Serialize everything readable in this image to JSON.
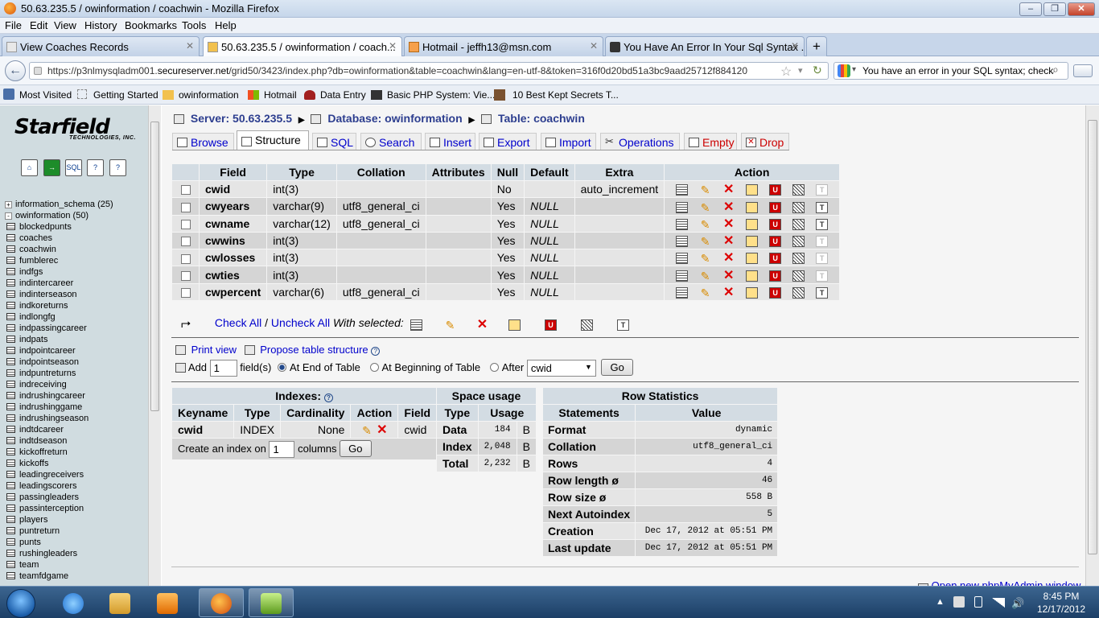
{
  "window": {
    "title": "50.63.235.5 / owinformation / coachwin - Mozilla Firefox"
  },
  "menu": [
    "File",
    "Edit",
    "View",
    "History",
    "Bookmarks",
    "Tools",
    "Help"
  ],
  "tabs": [
    {
      "label": "View Coaches Records"
    },
    {
      "label": "50.63.235.5 / owinformation / coach..."
    },
    {
      "label": "Hotmail - jeffh13@msn.com"
    },
    {
      "label": "You Have An Error In Your Sql Syntax ..."
    }
  ],
  "nav": {
    "url_prefix": "https://p3nlmysqladm001.",
    "url_domain": "secureserver.net",
    "url_rest": "/grid50/3423/index.php?db=owinformation&table=coachwin&lang=en-utf-8&token=316f0d20bd51a3bc9aad25712f884120",
    "search": "You have an error in your SQL syntax; check"
  },
  "bookmarks": [
    "Most Visited",
    "Getting Started",
    "owinformation",
    "Hotmail",
    "Data Entry",
    "Basic PHP System: Vie...",
    "10 Best Kept Secrets T..."
  ],
  "sidebar": {
    "logo": "Starfield",
    "logo_sub": "TECHNOLOGIES, INC.",
    "dbs": [
      {
        "name": "information_schema (25)",
        "sign": "+"
      },
      {
        "name": "owinformation (50)",
        "sign": "-"
      }
    ],
    "tables": [
      "blockedpunts",
      "coaches",
      "coachwin",
      "fumblerec",
      "indfgs",
      "indintercareer",
      "indinterseason",
      "indkoreturns",
      "indlongfg",
      "indpassingcareer",
      "indpats",
      "indpointcareer",
      "indpointseason",
      "indpuntreturns",
      "indreceiving",
      "indrushingcareer",
      "indrushinggame",
      "indrushingseason",
      "indtdcareer",
      "indtdseason",
      "kickoffreturn",
      "kickoffs",
      "leadingreceivers",
      "leadingscorers",
      "passingleaders",
      "passinterception",
      "players",
      "puntreturn",
      "punts",
      "rushingleaders",
      "team",
      "teamfdgame"
    ]
  },
  "breadcrumb": {
    "server": "Server: 50.63.235.5",
    "database": "Database: owinformation",
    "table": "Table: coachwin"
  },
  "pma_tabs": [
    {
      "label": "Browse"
    },
    {
      "label": "Structure"
    },
    {
      "label": "SQL"
    },
    {
      "label": "Search"
    },
    {
      "label": "Insert"
    },
    {
      "label": "Export"
    },
    {
      "label": "Import"
    },
    {
      "label": "Operations"
    },
    {
      "label": "Empty"
    },
    {
      "label": "Drop"
    }
  ],
  "structure": {
    "headers": [
      "Field",
      "Type",
      "Collation",
      "Attributes",
      "Null",
      "Default",
      "Extra",
      "Action"
    ],
    "rows": [
      {
        "field": "cwid",
        "type": "int(3)",
        "collation": "",
        "attributes": "",
        "null": "No",
        "default": "",
        "extra": "auto_increment"
      },
      {
        "field": "cwyears",
        "type": "varchar(9)",
        "collation": "utf8_general_ci",
        "attributes": "",
        "null": "Yes",
        "default": "NULL",
        "extra": ""
      },
      {
        "field": "cwname",
        "type": "varchar(12)",
        "collation": "utf8_general_ci",
        "attributes": "",
        "null": "Yes",
        "default": "NULL",
        "extra": ""
      },
      {
        "field": "cwwins",
        "type": "int(3)",
        "collation": "",
        "attributes": "",
        "null": "Yes",
        "default": "NULL",
        "extra": ""
      },
      {
        "field": "cwlosses",
        "type": "int(3)",
        "collation": "",
        "attributes": "",
        "null": "Yes",
        "default": "NULL",
        "extra": ""
      },
      {
        "field": "cwties",
        "type": "int(3)",
        "collation": "",
        "attributes": "",
        "null": "Yes",
        "default": "NULL",
        "extra": ""
      },
      {
        "field": "cwpercent",
        "type": "varchar(6)",
        "collation": "utf8_general_ci",
        "attributes": "",
        "null": "Yes",
        "default": "NULL",
        "extra": ""
      }
    ],
    "check_all": "Check All",
    "sep": "/",
    "uncheck_all": "Uncheck All",
    "with_selected": "With selected:"
  },
  "tools": {
    "print_view": "Print view",
    "propose": "Propose table structure",
    "add": "Add",
    "add_count": "1",
    "fields": "field(s)",
    "at_end": "At End of Table",
    "at_begin": "At Beginning of Table",
    "after": "After",
    "after_field": "cwid",
    "go": "Go"
  },
  "indexes": {
    "title": "Indexes:",
    "headers": [
      "Keyname",
      "Type",
      "Cardinality",
      "Action",
      "Field"
    ],
    "row": {
      "keyname": "cwid",
      "type": "INDEX",
      "cardinality": "None",
      "field": "cwid"
    },
    "create_prefix": "Create an index on",
    "create_count": "1",
    "create_suffix": "columns",
    "go": "Go"
  },
  "space": {
    "title": "Space usage",
    "headers": [
      "Type",
      "Usage"
    ],
    "rows": [
      {
        "type": "Data",
        "usage": "184",
        "unit": "B"
      },
      {
        "type": "Index",
        "usage": "2,048",
        "unit": "B"
      },
      {
        "type": "Total",
        "usage": "2,232",
        "unit": "B"
      }
    ]
  },
  "rowstats": {
    "title": "Row Statistics",
    "headers": [
      "Statements",
      "Value"
    ],
    "rows": [
      {
        "label": "Format",
        "value": "dynamic"
      },
      {
        "label": "Collation",
        "value": "utf8_general_ci"
      },
      {
        "label": "Rows",
        "value": "4"
      },
      {
        "label": "Row length ø",
        "value": "46"
      },
      {
        "label": "Row size ø",
        "value": "558 B"
      },
      {
        "label": "Next Autoindex",
        "value": "5"
      },
      {
        "label": "Creation",
        "value": "Dec 17, 2012 at 05:51 PM"
      },
      {
        "label": "Last update",
        "value": "Dec 17, 2012 at 05:51 PM"
      }
    ]
  },
  "footer_link": "Open new phpMyAdmin window",
  "clock": {
    "time": "8:45 PM",
    "date": "12/17/2012"
  },
  "colors": {
    "link": "#0000cc",
    "header": "#d3dce3",
    "sidebar": "#d0dce0"
  }
}
